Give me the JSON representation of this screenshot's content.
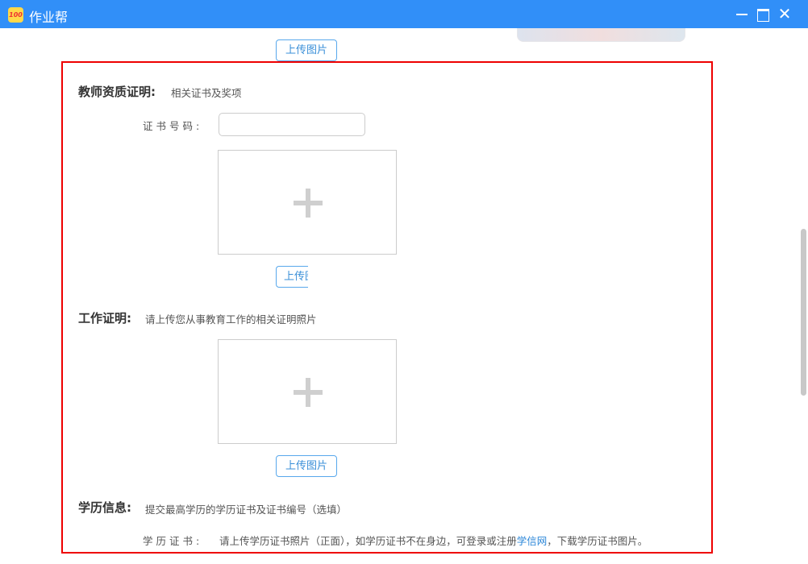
{
  "window": {
    "title": "作业帮",
    "logo_text": "100"
  },
  "upload_label": "上传图片",
  "teacher_cert": {
    "heading": "教师资质证明:",
    "desc": "相关证书及奖项",
    "number_label": "证书号码:",
    "number_value": "",
    "upload_button": "上传图片"
  },
  "work_proof": {
    "heading": "工作证明:",
    "desc": "请上传您从事教育工作的相关证明照片",
    "upload_button": "上传图片"
  },
  "education": {
    "heading": "学历信息:",
    "desc": "提交最高学历的学历证书及证书编号（选填）",
    "cert_label": "学历证书:",
    "hint_before": "请上传学历证书照片（正面），如学历证书不在身边，可登录或注册",
    "link": "学信网",
    "hint_after": "，下载学历证书图片。"
  }
}
